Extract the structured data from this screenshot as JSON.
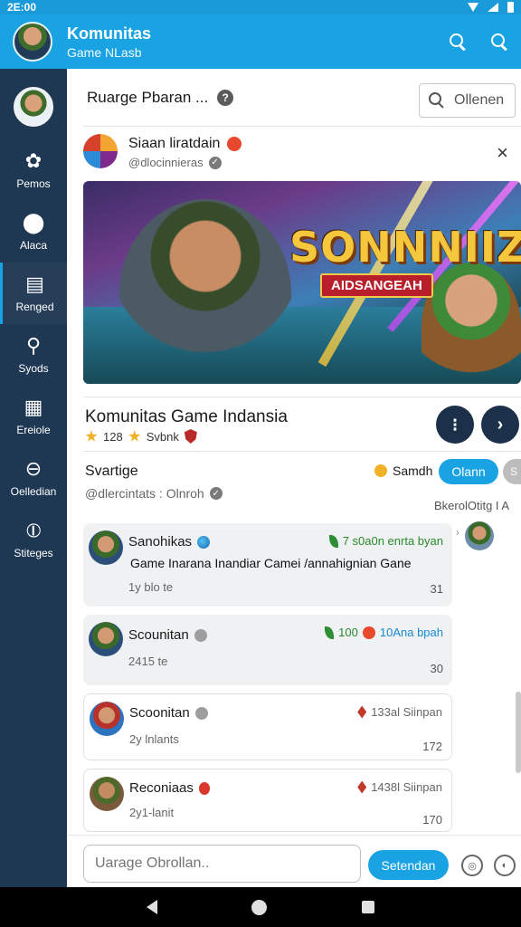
{
  "status_bar": {
    "time": "2E:00"
  },
  "app_bar": {
    "title": "Komunitas",
    "subtitle": "Game NLasb"
  },
  "sidebar": {
    "items": [
      {
        "label": "Pemos",
        "icon": "gear-icon"
      },
      {
        "label": "Alaca",
        "icon": "mushroom-icon"
      },
      {
        "label": "Renged",
        "icon": "document-icon"
      },
      {
        "label": "Syods",
        "icon": "key-icon"
      },
      {
        "label": "Ereiole",
        "icon": "grid-icon"
      },
      {
        "label": "Oelledian",
        "icon": "divide-icon"
      },
      {
        "label": "Stiteges",
        "icon": "circle-line-icon"
      }
    ]
  },
  "header": {
    "title": "Ruarge Pbaran ...",
    "help": "?",
    "search_label": "Ollenen"
  },
  "post": {
    "name": "Siaan liratdain",
    "handle": "@dlocinnieras",
    "close": "×",
    "banner_title": "SONNNIIZAI",
    "banner_subtitle": "AIDSANGEAH"
  },
  "community": {
    "title": "Komunitas Game Indansia",
    "meta_count": "128",
    "meta_label": "Svbnk",
    "btn1": "⁝",
    "btn2": "›"
  },
  "sort": {
    "label": "Svartige",
    "handle": "@dlercintats : Olnroh",
    "right_label": "Samdh",
    "primary_pill": "Olann",
    "grey_pill": "S",
    "right_caption": "BkerolOtitg I A"
  },
  "messages": [
    {
      "name": "Sanohikas",
      "stat": "7 s0a0n enrta byan",
      "text": "Game Inarana Inandiar Camei /annahignian Gane",
      "sub": "1y blo te",
      "count": "31"
    },
    {
      "name": "Scounitan",
      "stat_num": "100",
      "stat": "10Ana bpah",
      "sub": "2415 te",
      "count": "30"
    },
    {
      "name": "Scoonitan",
      "stat": "133al Siinpan",
      "sub": "2y lnlants",
      "count": "172"
    },
    {
      "name": "Reconiaas",
      "stat": "1438l Siinpan",
      "sub": "2y1-lanit",
      "count": "170"
    }
  ],
  "composer": {
    "placeholder": "Uarage Obrollan..",
    "send_label": "Setendan"
  },
  "colors": {
    "primary": "#1aa3e3",
    "sidebar": "#1e3752",
    "dark_button": "#1c3149"
  }
}
